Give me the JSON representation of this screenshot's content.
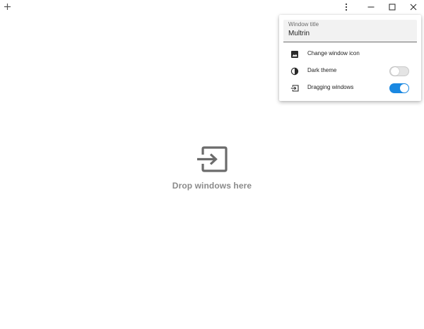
{
  "titlebar": {
    "add_tab_icon": "plus-icon",
    "more_icon": "more-vert-icon",
    "minimize_icon": "minimize-icon",
    "maximize_icon": "maximize-icon",
    "close_icon": "close-icon"
  },
  "drop_zone": {
    "icon": "input-arrow-icon",
    "text": "Drop windows here"
  },
  "settings_popup": {
    "title_field": {
      "label": "Window title",
      "value": "Multrin"
    },
    "items": [
      {
        "label": "Change window icon",
        "icon": "image-icon"
      },
      {
        "label": "Dark theme",
        "icon": "contrast-icon",
        "toggle": "off"
      },
      {
        "label": "Dragging windows",
        "icon": "input-arrow-icon",
        "toggle": "on"
      }
    ]
  },
  "colors": {
    "accent": "#1a88e1",
    "muted_text": "#8a8a8a",
    "icon_gray": "#6b6b6b"
  }
}
